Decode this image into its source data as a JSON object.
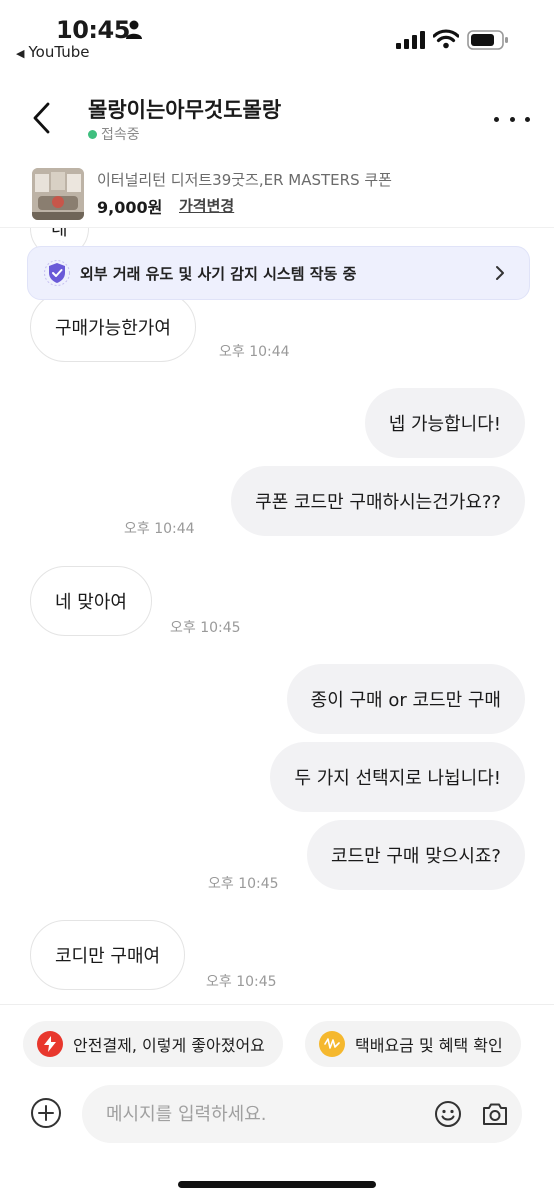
{
  "status_bar": {
    "time": "10:45",
    "back_app": "YouTube"
  },
  "header": {
    "title": "몰랑이는아무것도몰랑",
    "status": "접속중"
  },
  "product": {
    "name": "이터널리턴 디저트39굿즈,ER MASTERS 쿠폰",
    "price": "9,000원",
    "price_change": "가격변경"
  },
  "fraud_banner": {
    "text": "외부 거래 유도 및 사기 감지 시스템 작동 중"
  },
  "messages": [
    {
      "side": "in",
      "text": "네"
    },
    {
      "side": "in",
      "text": "구매가능한가여",
      "time": "오후 10:44"
    },
    {
      "side": "out",
      "text": "넵 가능합니다!"
    },
    {
      "side": "out",
      "text": "쿠폰 코드만 구매하시는건가요??",
      "time": "오후 10:44"
    },
    {
      "side": "in",
      "text": "네 맞아여",
      "time": "오후 10:45"
    },
    {
      "side": "out",
      "text": "종이 구매 or 코드만 구매"
    },
    {
      "side": "out",
      "text": "두 가지 선택지로 나뉩니다!"
    },
    {
      "side": "out",
      "text": "코드만 구매 맞으시죠?",
      "time": "오후 10:45"
    },
    {
      "side": "in",
      "text": "코디만 구매여",
      "time": "오후 10:45"
    }
  ],
  "quick_actions": [
    {
      "label": "안전결제, 이렇게 좋아졌어요",
      "icon": "lightning-icon",
      "color": "#e8372d"
    },
    {
      "label": "택배요금 및 혜택 확인",
      "icon": "coin-icon",
      "color": "#f5b82e"
    }
  ],
  "input": {
    "placeholder": "메시지를 입력하세요."
  },
  "colors": {
    "online_dot": "#3fbf7f",
    "banner_bg": "#eef0fd",
    "shield": "#6a5ad8"
  }
}
